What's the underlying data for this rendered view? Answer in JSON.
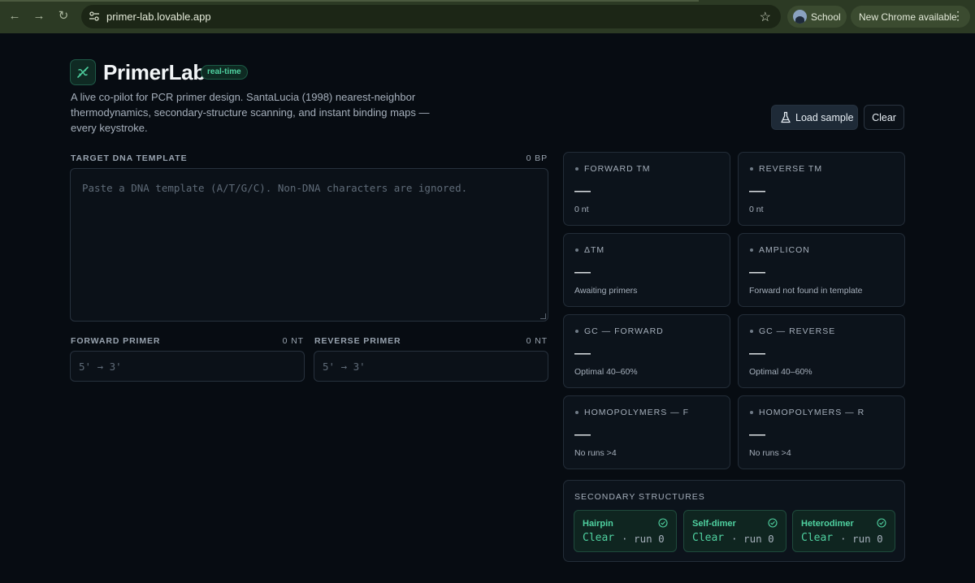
{
  "browser": {
    "url": "primer-lab.lovable.app",
    "profile_name": "School",
    "update_label": "New Chrome available",
    "icons": {
      "back": "arrow-left-icon",
      "forward": "arrow-right-icon",
      "reload": "reload-icon",
      "site_info": "tune-icon",
      "bookmark": "star-icon",
      "menu": "kebab-menu-icon"
    }
  },
  "header": {
    "title": "PrimerLab",
    "badge": "real-time",
    "description": "A live co-pilot for PCR primer design. SantaLucia (1998) nearest-neighbor thermodynamics, secondary-structure scanning, and instant binding maps — every keystroke."
  },
  "actions": {
    "load_sample": "Load sample",
    "clear": "Clear"
  },
  "template": {
    "label": "TARGET DNA TEMPLATE",
    "count": "0 BP",
    "placeholder": "Paste a DNA template (A/T/G/C). Non-DNA characters are ignored."
  },
  "forward_primer": {
    "label": "FORWARD PRIMER",
    "count": "0 NT",
    "placeholder": "5' → 3'"
  },
  "reverse_primer": {
    "label": "REVERSE PRIMER",
    "count": "0 NT",
    "placeholder": "5' → 3'"
  },
  "stats": [
    {
      "title": "FORWARD TM",
      "value": "—",
      "sub": "0 nt"
    },
    {
      "title": "REVERSE TM",
      "value": "—",
      "sub": "0 nt"
    },
    {
      "title": "ΔTM",
      "value": "—",
      "sub": "Awaiting primers"
    },
    {
      "title": "AMPLICON",
      "value": "—",
      "sub": "Forward not found in template"
    },
    {
      "title": "GC — FORWARD",
      "value": "—",
      "sub": "Optimal 40–60%"
    },
    {
      "title": "GC — REVERSE",
      "value": "—",
      "sub": "Optimal 40–60%"
    },
    {
      "title": "HOMOPOLYMERS — F",
      "value": "—",
      "sub": "No runs >4"
    },
    {
      "title": "HOMOPOLYMERS — R",
      "value": "—",
      "sub": "No runs >4"
    }
  ],
  "secondary": {
    "title": "SECONDARY STRUCTURES",
    "items": [
      {
        "name": "Hairpin",
        "status": "Clear",
        "run": "· run 0"
      },
      {
        "name": "Self-dimer",
        "status": "Clear",
        "run": "· run 0"
      },
      {
        "name": "Heterodimer",
        "status": "Clear",
        "run": "· run 0"
      }
    ]
  },
  "colors": {
    "accent": "#4fd1a0",
    "background": "#070c12",
    "card": "#0c131b"
  }
}
